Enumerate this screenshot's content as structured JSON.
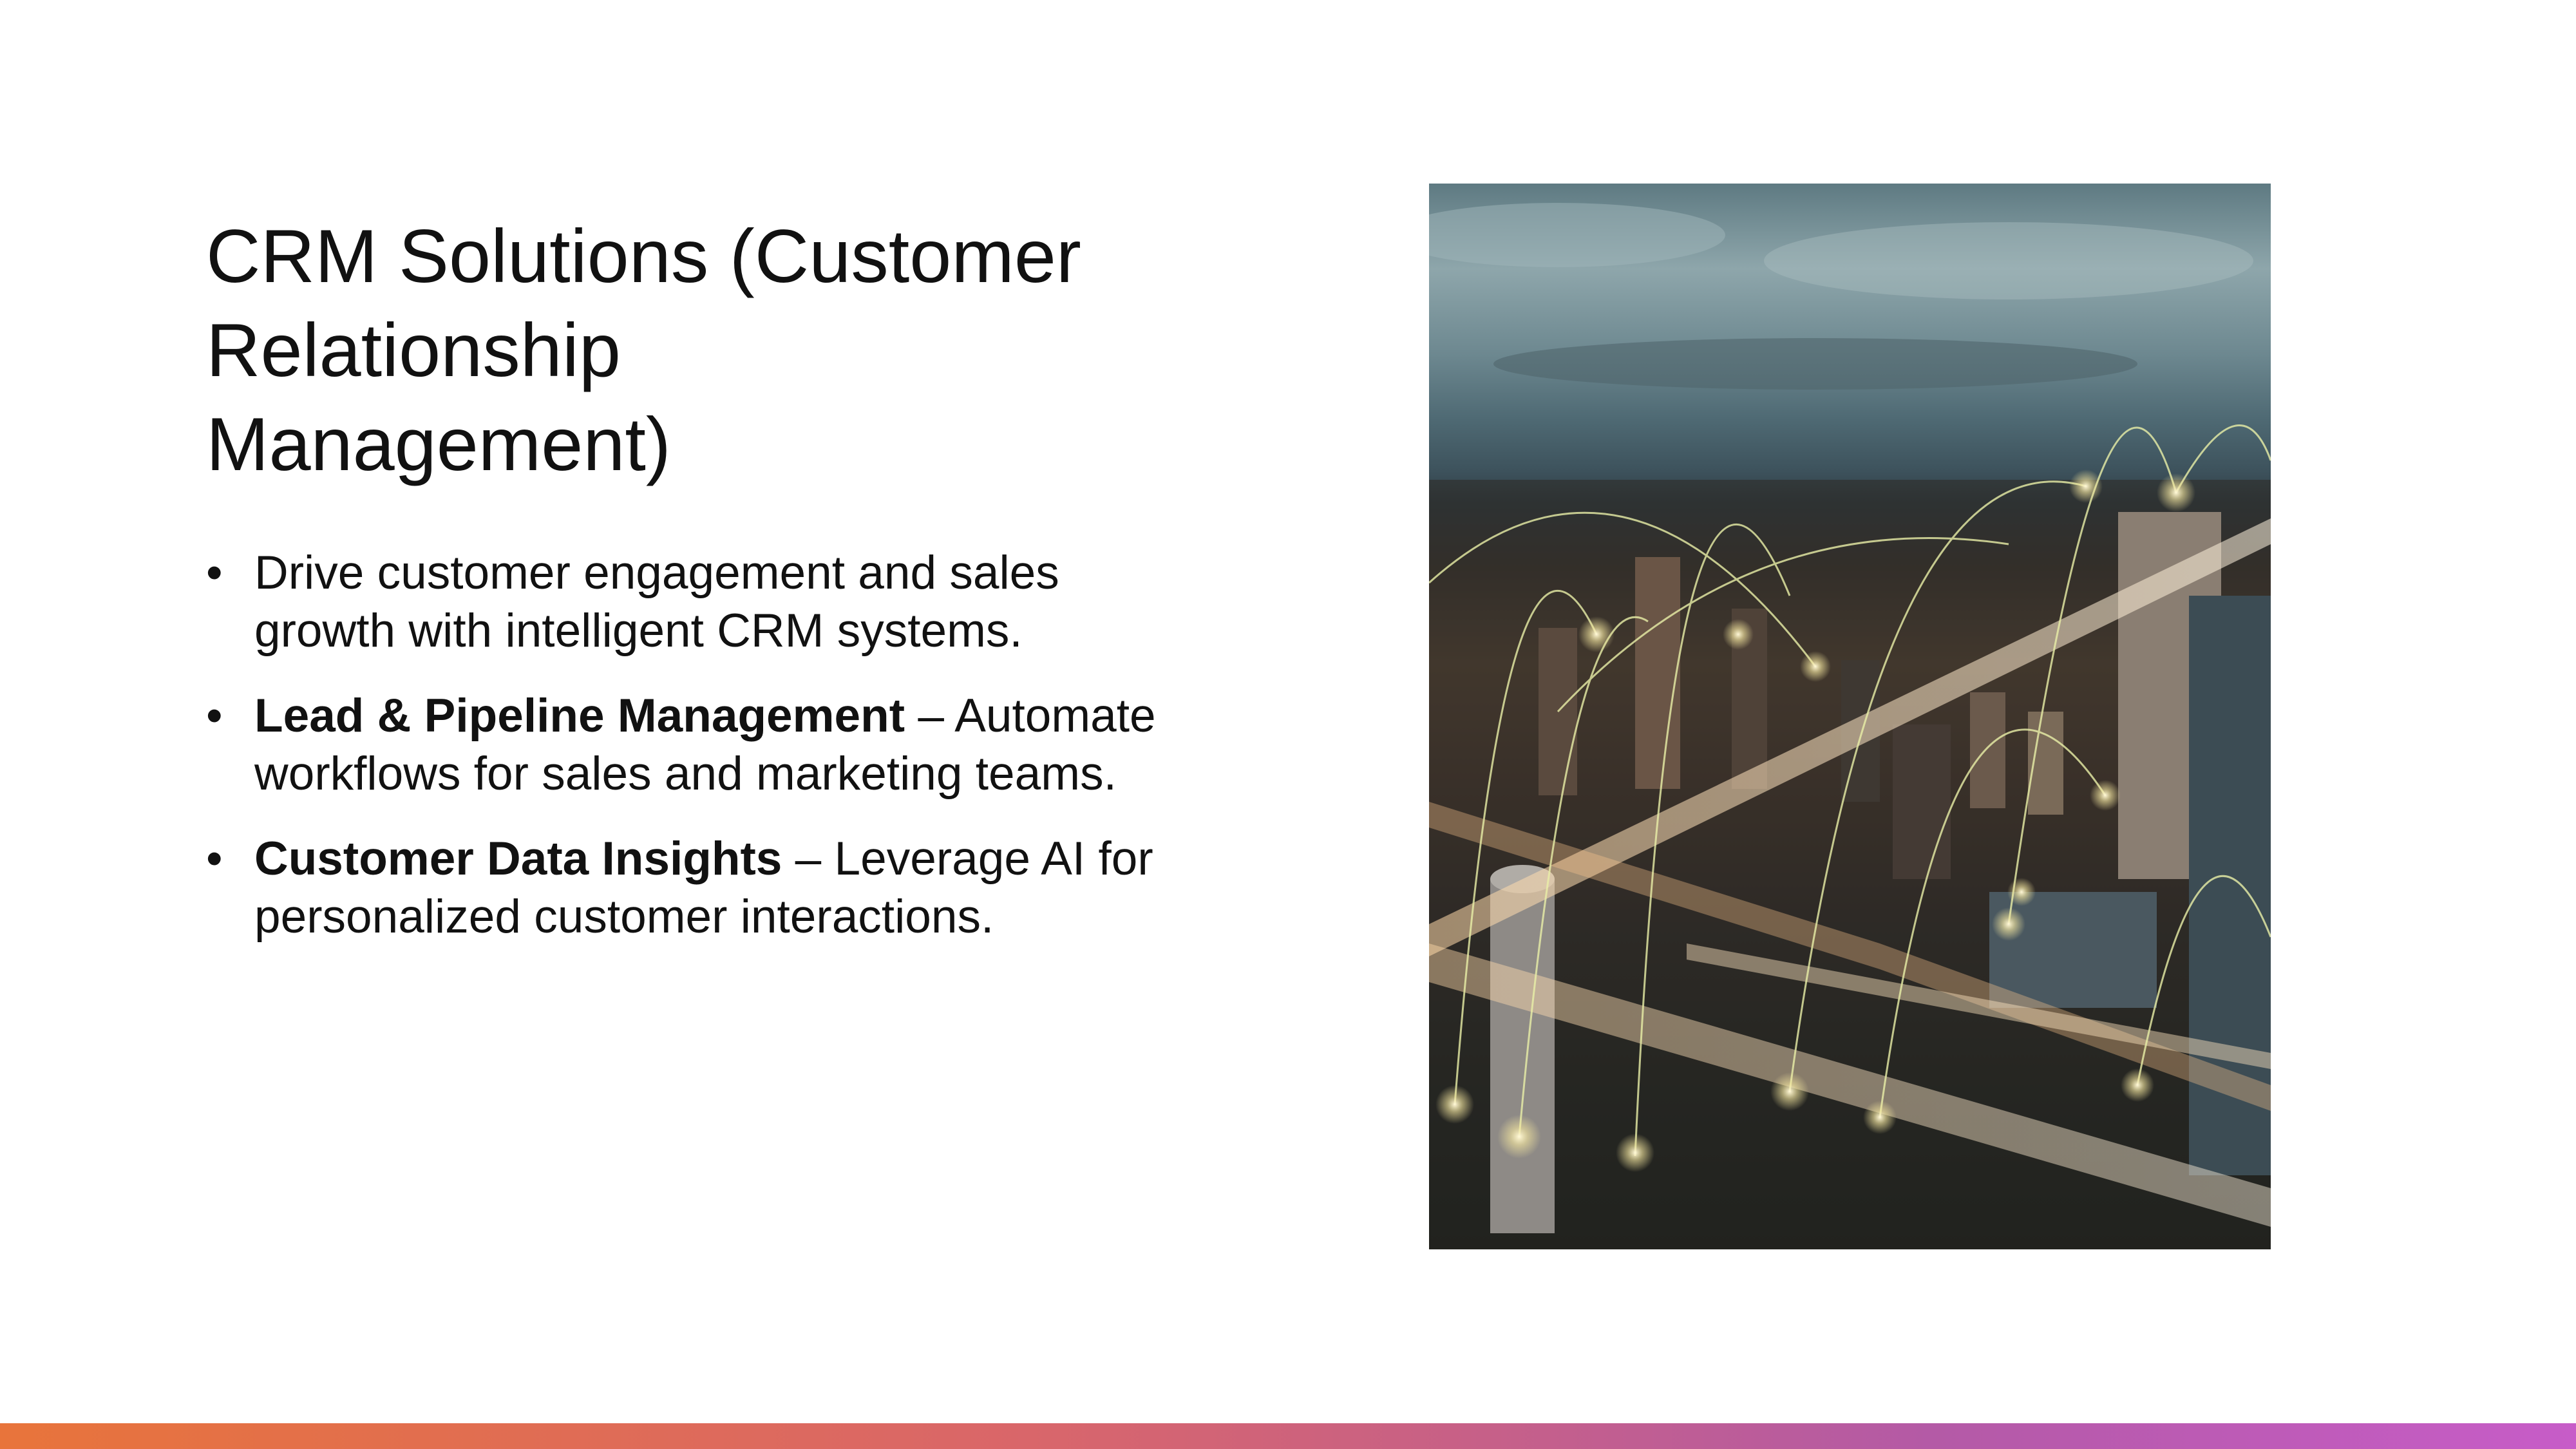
{
  "slide": {
    "title_lines": [
      "CRM Solutions (Customer",
      "Relationship",
      "Management)"
    ],
    "bullets": [
      {
        "bold": "",
        "text": "Drive customer engagement and sales growth with intelligent CRM systems."
      },
      {
        "bold": "Lead & Pipeline Management",
        "text": " – Automate workflows for sales and marketing teams."
      },
      {
        "bold": "Customer Data Insights",
        "text": " – Leverage AI for personalized customer interactions."
      }
    ],
    "bullet_glyph": "•"
  },
  "image": {
    "subject": "night city aerial with highway light trails and network arcs"
  },
  "colors": {
    "accent_start": "#e8743b",
    "accent_end": "#c75cc8",
    "text": "#111111"
  }
}
